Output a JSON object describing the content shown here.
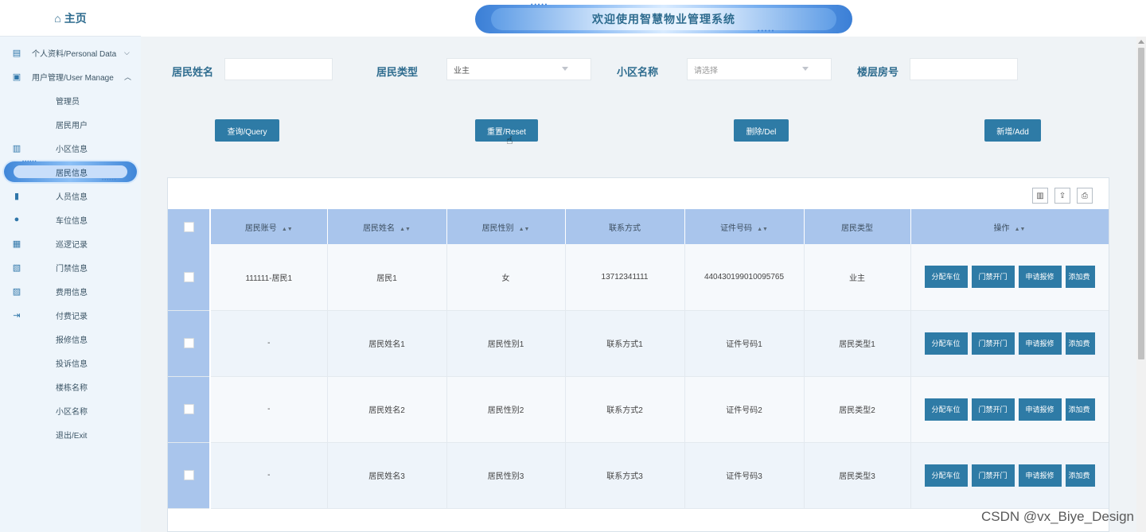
{
  "sidebar": {
    "home": "主页",
    "items": [
      {
        "label": "个人资料/Personal Data",
        "chev": "⌵"
      },
      {
        "label": "用户管理/User Manage",
        "chev": "︿"
      },
      {
        "label": "管理员"
      },
      {
        "label": "居民用户"
      },
      {
        "label": "小区信息"
      },
      {
        "label": "居民信息"
      },
      {
        "label": "人员信息"
      },
      {
        "label": "车位信息"
      },
      {
        "label": "巡逻记录"
      },
      {
        "label": "门禁信息"
      },
      {
        "label": "费用信息"
      },
      {
        "label": "付费记录"
      },
      {
        "label": "报修信息"
      },
      {
        "label": "投诉信息"
      },
      {
        "label": "楼栋名称"
      },
      {
        "label": "小区名称"
      },
      {
        "label": "退出/Exit"
      }
    ]
  },
  "header": {
    "title": "欢迎使用智慧物业管理系统"
  },
  "filters": {
    "name_label": "居民姓名",
    "name_value": "",
    "type_label": "居民类型",
    "type_value": "业主",
    "community_label": "小区名称",
    "community_placeholder": "请选择",
    "room_label": "楼层房号",
    "room_value": ""
  },
  "buttons": {
    "query": "查询/Query",
    "reset": "重置/Reset",
    "delete": "删除/Del",
    "add": "新增/Add"
  },
  "table": {
    "headers": [
      "居民账号",
      "居民姓名",
      "居民性别",
      "联系方式",
      "证件号码",
      "居民类型",
      "操作"
    ],
    "rows": [
      [
        "111111-居民1",
        "居民1",
        "女",
        "13712341111",
        "440430199010095765",
        "业主"
      ],
      [
        "-",
        "居民姓名1",
        "居民性别1",
        "联系方式1",
        "证件号码1",
        "居民类型1"
      ],
      [
        "-",
        "居民姓名2",
        "居民性别2",
        "联系方式2",
        "证件号码2",
        "居民类型2"
      ],
      [
        "-",
        "居民姓名3",
        "居民性别3",
        "联系方式3",
        "证件号码3",
        "居民类型3"
      ]
    ],
    "ops": [
      "分配车位",
      "门禁开门",
      "申请报修",
      "添加费"
    ]
  },
  "watermark": "CSDN @vx_Biye_Design",
  "colors": {
    "primary": "#2e7ba6",
    "header_row": "#a9c5ec",
    "title": "#2d6b8e"
  }
}
